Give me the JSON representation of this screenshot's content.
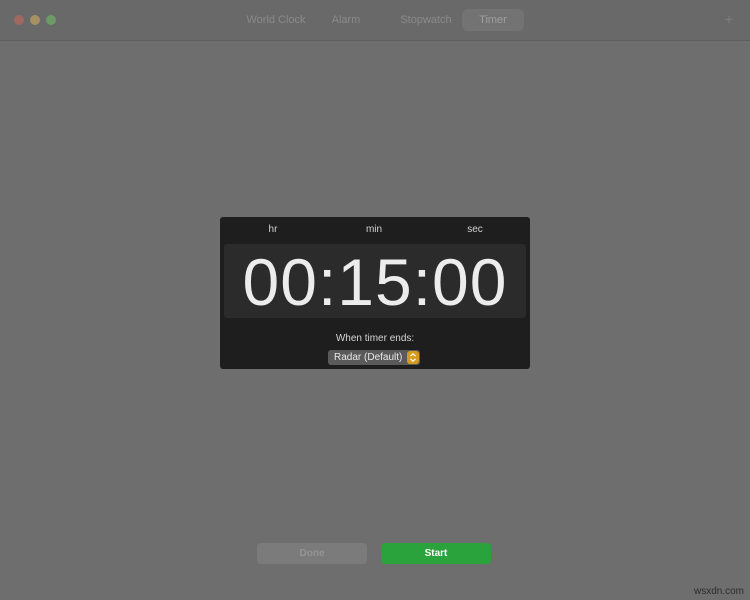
{
  "tabs": [
    {
      "label": "World Clock"
    },
    {
      "label": "Alarm"
    },
    {
      "label": "Stopwatch"
    },
    {
      "label": "Timer",
      "active": true
    }
  ],
  "toolbar": {
    "add_icon": "plus-icon"
  },
  "timer": {
    "units": {
      "hr": "hr",
      "min": "min",
      "sec": "sec"
    },
    "display": "00:15:00",
    "ends_label": "When timer ends:",
    "sound": "Radar (Default)"
  },
  "buttons": {
    "done": "Done",
    "start": "Start"
  },
  "watermark": "wsxdn.com",
  "colors": {
    "background": "#6e6e6e",
    "panel": "#1e1e1e",
    "start_button": "#2aa33c",
    "stepper": "#d59b1c"
  }
}
